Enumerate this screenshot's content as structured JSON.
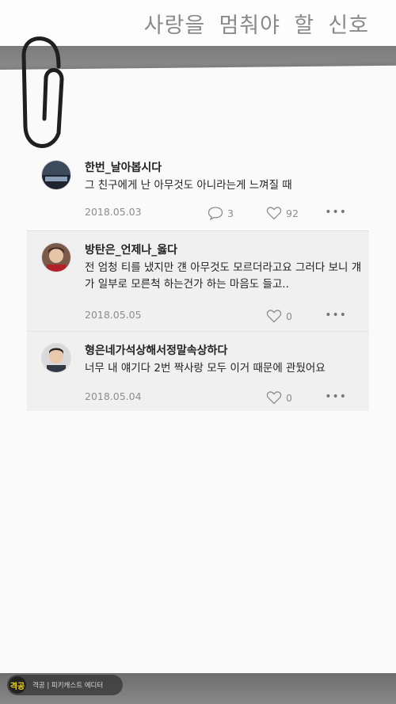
{
  "header": {
    "title": "사랑을 멈춰야 할 신호"
  },
  "comments": [
    {
      "username": "한번_날아봅시다",
      "text": "그 친구에게 난 아무것도 아니라는게 느껴질 때",
      "date": "2018.05.03",
      "reply_count": "3",
      "like_count": "92"
    },
    {
      "username": "방탄은_언제나_옳다",
      "text": "전 엄청 티를 냈지만 걘 아무것도 모르더라고요 그러다 보니 걔가 일부로 모른척 하는건가 하는 마음도 들고..",
      "date": "2018.05.05",
      "like_count": "0"
    },
    {
      "username": "형은네가석상해서정말속상하다",
      "text": "너무 내 얘기다 2번 짝사랑 모두 이거 때문에 관뒀어요",
      "date": "2018.05.04",
      "like_count": "0"
    }
  ],
  "more_label": "•••",
  "badge": {
    "logo": "격공",
    "text": "격공 | 피키캐스트 에디터"
  }
}
